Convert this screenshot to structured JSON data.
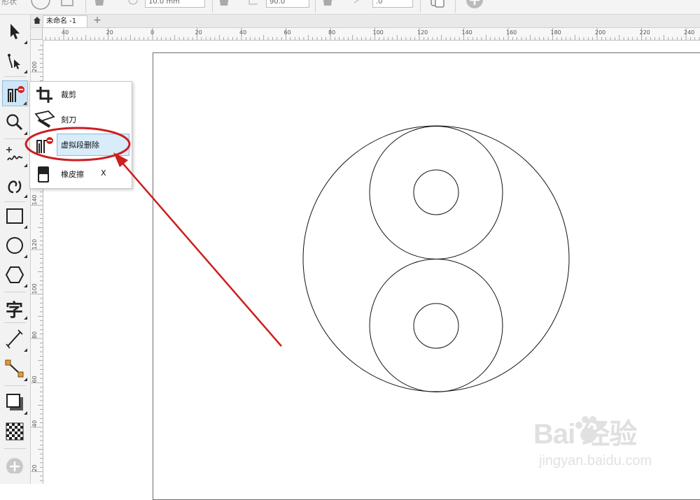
{
  "property_bar": {
    "label_partial": "形状",
    "size_value": "10.0 mm",
    "angle_value": "90.0",
    "extra_value": ".0"
  },
  "document_tab": {
    "title": "未命名 -1",
    "add_label": "+"
  },
  "ruler": {
    "horizontal_labels": [
      "40",
      "20",
      "0",
      "20",
      "40",
      "60",
      "80",
      "100",
      "120",
      "140",
      "160",
      "180",
      "200",
      "220",
      "240"
    ],
    "vertical_labels": [
      "200",
      "180",
      "160",
      "140",
      "120",
      "100",
      "80",
      "60",
      "40",
      "20"
    ]
  },
  "toolbox": {
    "tools": [
      {
        "name": "pick-tool",
        "icon": "arrow-icon"
      },
      {
        "name": "shape-tool",
        "icon": "shape-node-icon"
      },
      {
        "name": "virtual-segment-delete-tool",
        "icon": "virtual-segment-delete-icon",
        "active": true
      },
      {
        "name": "zoom-tool",
        "icon": "magnifier-icon"
      },
      {
        "name": "freehand-tool",
        "icon": "freehand-icon"
      },
      {
        "name": "artistic-media-tool",
        "icon": "spiral-pen-icon"
      },
      {
        "name": "rectangle-tool",
        "icon": "rectangle-icon"
      },
      {
        "name": "ellipse-tool",
        "icon": "ellipse-icon"
      },
      {
        "name": "polygon-tool",
        "icon": "hexagon-icon"
      },
      {
        "name": "text-tool",
        "icon": "text-icon",
        "glyph": "字"
      },
      {
        "name": "dimension-tool",
        "icon": "dimension-line-icon"
      },
      {
        "name": "connector-tool",
        "icon": "connector-icon"
      },
      {
        "name": "drop-shadow-tool",
        "icon": "drop-shadow-icon"
      },
      {
        "name": "transparency-tool",
        "icon": "checkerboard-icon"
      },
      {
        "name": "add-tool",
        "icon": "plus-circle-icon"
      }
    ]
  },
  "flyout": {
    "items": [
      {
        "label": "裁剪",
        "icon": "crop-icon",
        "shortcut": ""
      },
      {
        "label": "刻刀",
        "icon": "knife-icon",
        "shortcut": ""
      },
      {
        "label": "虚拟段删除",
        "icon": "virtual-segment-delete-icon",
        "shortcut": "",
        "selected": true
      },
      {
        "label": "橡皮擦",
        "icon": "eraser-icon",
        "shortcut": "X"
      }
    ]
  },
  "watermark": {
    "logo": "Bai 经验",
    "url": "jingyan.baidu.com"
  },
  "colors": {
    "annotation_red": "#cc1f1f",
    "selection_blue": "#d8ecfa",
    "toolbox_bg": "#f2f2f2"
  }
}
